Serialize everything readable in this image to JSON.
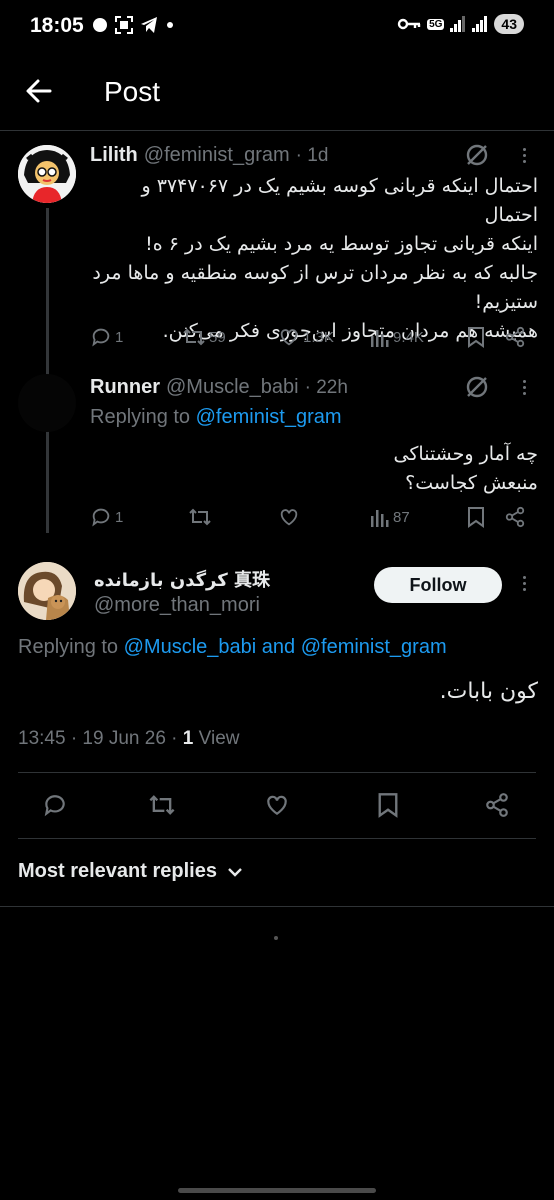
{
  "status_bar": {
    "time": "18:05",
    "battery": "43",
    "network": "5G"
  },
  "header": {
    "title": "Post"
  },
  "tweet1": {
    "name": "Lilith",
    "handle": "@feminist_gram",
    "time": "· 1d",
    "lines": [
      "احتمال اینکه قربانی کوسه بشیم یک در ۳۷۴۷۰۶۷ و احتمال",
      "اینکه قربانی تجاوز توسط یه مرد بشیم یک در ۶ ه!",
      "جالبه که به نظر مردان ترس از کوسه منطقیه و ماها مرد",
      "ستیزیم!",
      "همیشه هم مردان متجاوز این‌جوری فکر می‌کنن."
    ],
    "stats": {
      "replies": "1",
      "reposts": "59",
      "likes": "1.3K",
      "views": "9.4K"
    }
  },
  "tweet2": {
    "name": "Runner",
    "handle": "@Muscle_babi",
    "time": "· 22h",
    "replying_prefix": "Replying to",
    "replying_to": "@feminist_gram",
    "lines": [
      "چه آمار وحشتناکی",
      "منبعش کجاست؟"
    ],
    "stats": {
      "replies": "1",
      "views": "87"
    }
  },
  "main_tweet": {
    "name": "کرگدن بازمانده 真珠",
    "handle": "@more_than_mori",
    "follow_label": "Follow",
    "replying_prefix": "Replying to",
    "replying_to_1": "@Muscle_babi",
    "replying_and": "and",
    "replying_to_2": "@feminist_gram",
    "text": "کون بابات.",
    "timestamp": "13:45 · 19 Jun 26 ·",
    "views_count": "1",
    "views_label": "View"
  },
  "replies_sort": {
    "label": "Most relevant replies"
  },
  "colors": {
    "accent": "#1d9bf0",
    "background": "#000000",
    "muted": "#71767b"
  }
}
